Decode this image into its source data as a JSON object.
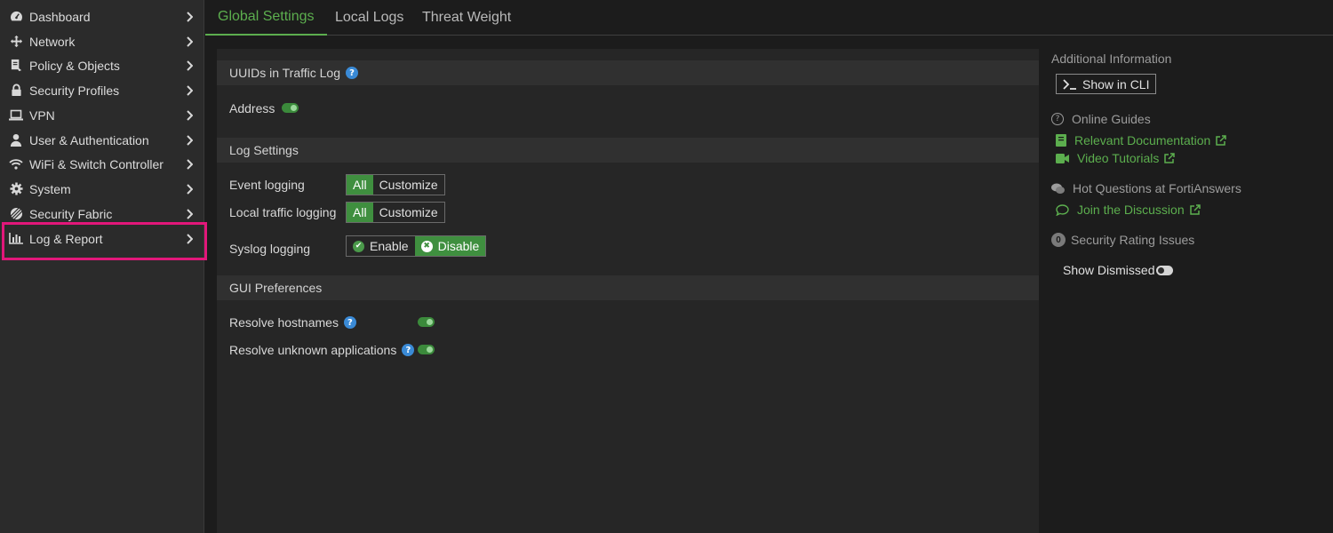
{
  "sidebar": {
    "items": [
      {
        "label": "Dashboard",
        "icon": "dashboard-icon"
      },
      {
        "label": "Network",
        "icon": "network-icon"
      },
      {
        "label": "Policy & Objects",
        "icon": "policy-icon"
      },
      {
        "label": "Security Profiles",
        "icon": "lock-icon"
      },
      {
        "label": "VPN",
        "icon": "laptop-icon"
      },
      {
        "label": "User & Authentication",
        "icon": "user-icon"
      },
      {
        "label": "WiFi & Switch Controller",
        "icon": "wifi-icon"
      },
      {
        "label": "System",
        "icon": "gear-icon"
      },
      {
        "label": "Security Fabric",
        "icon": "fabric-icon"
      },
      {
        "label": "Log & Report",
        "icon": "bar-chart-icon"
      }
    ],
    "highlighted": "Log & Report"
  },
  "tabs": [
    {
      "label": "Global Settings",
      "active": true
    },
    {
      "label": "Local Logs",
      "active": false
    },
    {
      "label": "Threat Weight",
      "active": false
    }
  ],
  "main": {
    "uuids": {
      "title": "UUIDs in Traffic Log",
      "address_label": "Address",
      "address_on": true
    },
    "log_settings": {
      "title": "Log Settings",
      "event_label": "Event logging",
      "local_label": "Local traffic logging",
      "syslog_label": "Syslog logging",
      "all": "All",
      "customize": "Customize",
      "enable": "Enable",
      "disable": "Disable",
      "event_selected": "All",
      "local_selected": "All",
      "syslog_selected": "Disable"
    },
    "gui": {
      "title": "GUI Preferences",
      "hostnames_label": "Resolve hostnames",
      "hostnames_on": true,
      "apps_label": "Resolve unknown applications",
      "apps_on": true
    }
  },
  "right": {
    "additional_info": "Additional Information",
    "show_cli": "Show in CLI",
    "online_guides": "Online Guides",
    "relevant_docs": "Relevant Documentation",
    "video_tutorials": "Video Tutorials",
    "hot_questions": "Hot Questions at FortiAnswers",
    "join_discussion": "Join the Discussion",
    "security_count": "0",
    "security_rating": "Security Rating Issues",
    "show_dismissed": "Show Dismissed",
    "show_dismissed_on": false
  },
  "colors": {
    "accent_green": "#5cae4e",
    "highlight_pink": "#e2177a",
    "help_blue": "#3a8ad6"
  }
}
